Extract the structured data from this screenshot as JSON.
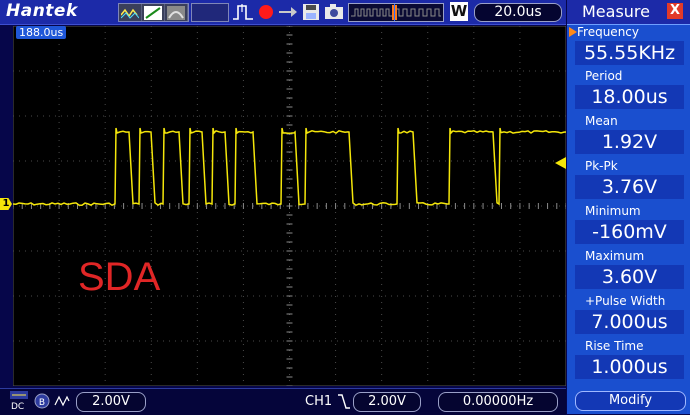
{
  "brand": "Hantek",
  "timebase": "20.0us",
  "timebase_mode": "W",
  "trigger_offset": "188.0us",
  "channel_marker": "1",
  "signal_label": "SDA",
  "colors": {
    "trace": "#f4e60a",
    "label": "#e02626",
    "panel": "#1a4fcf"
  },
  "measure": {
    "title": "Measure",
    "close": "X",
    "rows": [
      {
        "label": "Frequency",
        "value": "55.55KHz"
      },
      {
        "label": "Period",
        "value": "18.00us"
      },
      {
        "label": "Mean",
        "value": "1.92V"
      },
      {
        "label": "Pk-Pk",
        "value": "3.76V"
      },
      {
        "label": "Minimum",
        "value": "-160mV"
      },
      {
        "label": "Maximum",
        "value": "3.60V"
      },
      {
        "label": "+Pulse Width",
        "value": "7.000us"
      },
      {
        "label": "Rise Time",
        "value": "1.000us"
      }
    ],
    "footer": "Modify"
  },
  "bottom": {
    "coupling": "DC",
    "volts_div": "2.00V",
    "channel": "CH1",
    "trigger_level": "2.00V",
    "frequency": "0.00000Hz"
  }
}
